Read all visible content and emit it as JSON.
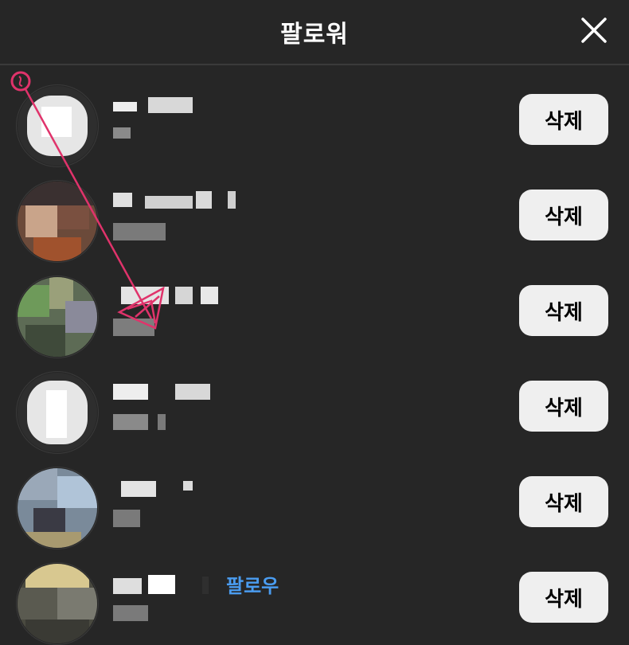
{
  "header": {
    "title": "팔로워",
    "close_icon": "close-icon"
  },
  "colors": {
    "background": "#262626",
    "button_bg": "#efefef",
    "button_text": "#000000",
    "follow_link": "#4a9cf0",
    "annotation": "#e0336b"
  },
  "followers": [
    {
      "delete_label": "삭제",
      "follow_label": ""
    },
    {
      "delete_label": "삭제",
      "follow_label": ""
    },
    {
      "delete_label": "삭제",
      "follow_label": ""
    },
    {
      "delete_label": "삭제",
      "follow_label": ""
    },
    {
      "delete_label": "삭제",
      "follow_label": ""
    },
    {
      "delete_label": "삭제",
      "follow_label": "팔로우"
    }
  ]
}
